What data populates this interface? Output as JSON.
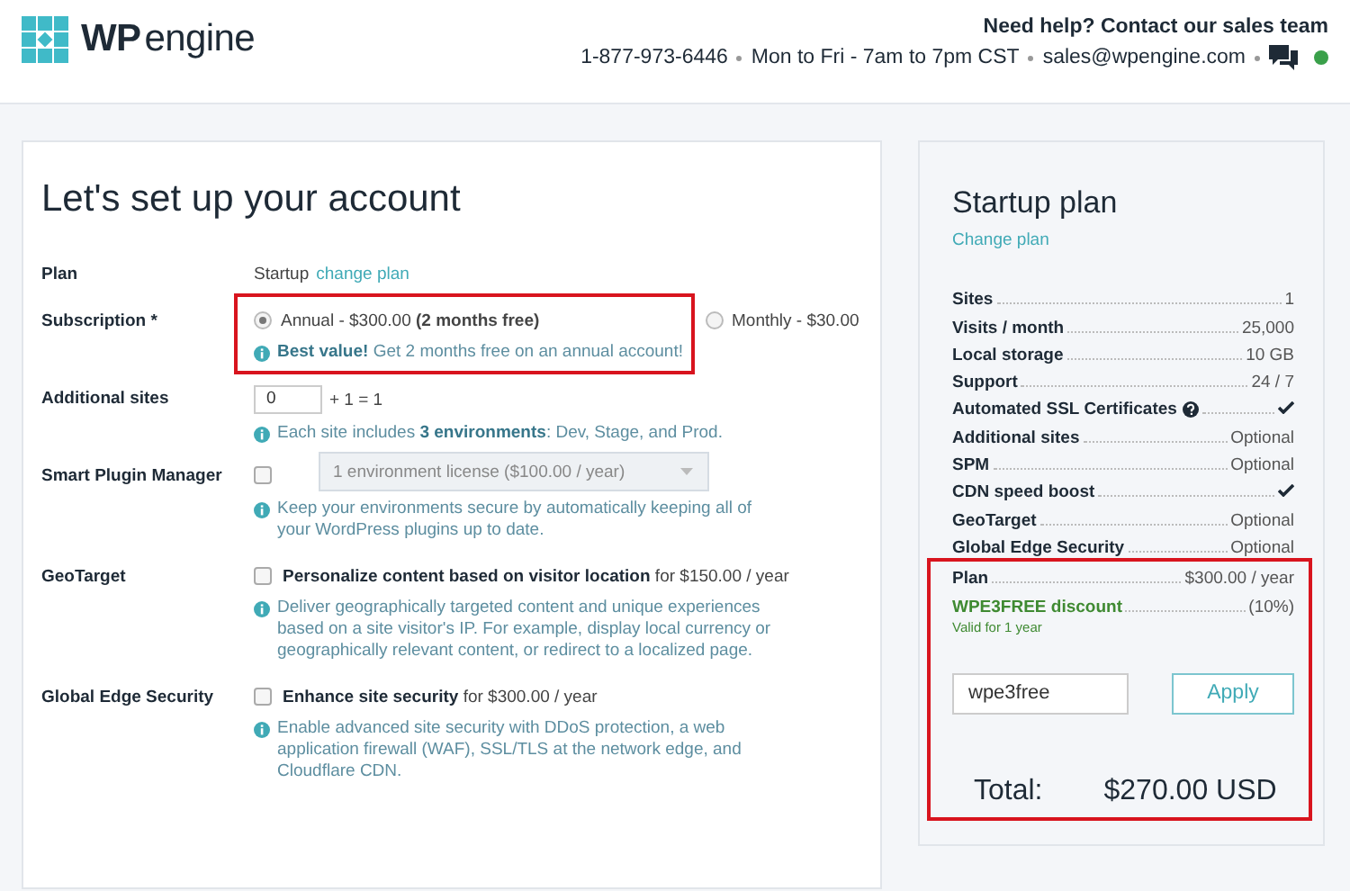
{
  "header": {
    "logo": {
      "bold": "WP",
      "light": "engine"
    },
    "help_title": "Need help? Contact our sales team",
    "phone": "1-877-973-6446",
    "hours": "Mon to Fri - 7am to 7pm CST",
    "email": "sales@wpengine.com",
    "online": true
  },
  "form": {
    "title": "Let's set up your account",
    "rows": [
      {
        "kind": "plan",
        "label": "Plan",
        "value": "Startup",
        "link": "change plan"
      },
      {
        "kind": "radios",
        "label": "Subscription *",
        "highlighted": true,
        "options": [
          {
            "text": "Annual - $300.00 **(2 months free)**",
            "selected": true
          },
          {
            "text": "Monthly - $30.00",
            "selected": false
          }
        ],
        "note": "**Best value!** Get 2 months free on an annual account!"
      },
      {
        "kind": "number",
        "label": "Additional sites",
        "value": "0",
        "suffix": "+ 1 = 1",
        "note": "Each site includes **3 environments**: Dev, Stage, and Prod."
      },
      {
        "kind": "select",
        "label": "Smart Plugin Manager",
        "checked": false,
        "select": "1 environment license ($100.00 / year)",
        "disabled": true,
        "note": "Keep your environments secure by automatically keeping all of your WordPress plugins up to date."
      },
      {
        "kind": "checkbox",
        "label": "GeoTarget",
        "checked": false,
        "text": "**Personalize content based on visitor location** for $150.00 / year",
        "note": "Deliver geographically targeted content and unique experiences based on a site visitor's IP. For example, display local currency or geographically relevant content, or redirect to a localized page."
      },
      {
        "kind": "checkbox",
        "label": "Global Edge Security",
        "checked": false,
        "text": "**Enhance site security** for $300.00 / year",
        "note": "Enable advanced site security with DDoS protection, a web application firewall (WAF), SSL/TLS at the network edge, and Cloudflare CDN."
      }
    ]
  },
  "summary": {
    "title": "Startup plan",
    "link": "Change plan",
    "features": [
      {
        "name": "Sites",
        "kind": "text",
        "value": "1"
      },
      {
        "name": "Visits / month",
        "kind": "text",
        "value": "25,000"
      },
      {
        "name": "Local storage",
        "kind": "text",
        "value": "10 GB"
      },
      {
        "name": "Support",
        "kind": "text",
        "value": "24 / 7"
      },
      {
        "name": "Automated SSL Certificates",
        "kind": "check",
        "help": true
      },
      {
        "name": "Additional sites",
        "kind": "text",
        "value": "Optional"
      },
      {
        "name": "SPM",
        "kind": "text",
        "value": "Optional"
      },
      {
        "name": "CDN speed boost",
        "kind": "check"
      },
      {
        "name": "GeoTarget",
        "kind": "text",
        "value": "Optional"
      },
      {
        "name": "Global Edge Security",
        "kind": "text",
        "value": "Optional"
      }
    ],
    "pricing": {
      "highlighted": true,
      "plan_label": "Plan",
      "plan_price": "$300.00 / year",
      "discount_label": "WPE3FREE discount",
      "discount_value": "(10%)",
      "discount_note": "Valid for 1 year",
      "coupon": "wpe3free",
      "apply": "Apply",
      "total_label": "Total:",
      "total": "$270.00 USD"
    }
  }
}
